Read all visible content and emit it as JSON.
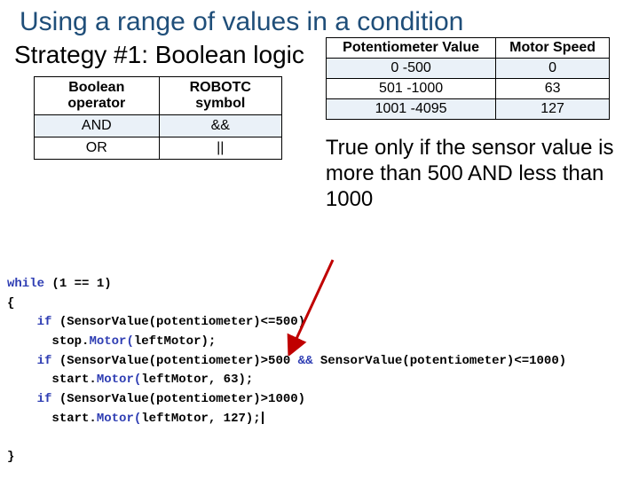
{
  "title": "Using a range of values in a condition",
  "subtitle": "Strategy #1: Boolean logic",
  "bool_table": {
    "headers": [
      "Boolean operator",
      "ROBOTC symbol"
    ],
    "rows": [
      [
        "AND",
        "&&"
      ],
      [
        "OR",
        "||"
      ]
    ]
  },
  "speed_table": {
    "headers": [
      "Potentiometer Value",
      "Motor Speed"
    ],
    "rows": [
      [
        "0 -500",
        "0"
      ],
      [
        "501 -1000",
        "63"
      ],
      [
        "1001 -4095",
        "127"
      ]
    ]
  },
  "explain": "True only if the sensor value is more than 500 AND less than 1000",
  "code": {
    "kw_while": "while",
    "cond1": " (1 == 1)",
    "lbrace": "{",
    "kw_if": "if",
    "if1": " (SensorValue(potentiometer)<=500)",
    "stmt1a": "stop.",
    "stmt1b": "Motor(",
    "stmt1c": "leftMotor);",
    "if2a": " (SensorValue(potentiometer)>500 ",
    "op_and": "&&",
    "if2b": " SensorValue(potentiometer)<=1000)",
    "stmt2a": "start.",
    "stmt2b": "Motor(",
    "stmt2c": "leftMotor, 63);",
    "if3": " (SensorValue(potentiometer)>1000)",
    "stmt3a": "start.",
    "stmt3b": "Motor(",
    "stmt3c": "leftMotor, 127);",
    "rbrace": "}"
  },
  "chart_data": [
    {
      "type": "table",
      "title": "Boolean operators to ROBOTC symbols",
      "columns": [
        "Boolean operator",
        "ROBOTC symbol"
      ],
      "rows": [
        [
          "AND",
          "&&"
        ],
        [
          "OR",
          "||"
        ]
      ]
    },
    {
      "type": "table",
      "title": "Potentiometer value to motor speed mapping",
      "columns": [
        "Potentiometer Value",
        "Motor Speed"
      ],
      "rows": [
        [
          "0-500",
          0
        ],
        [
          "501-1000",
          63
        ],
        [
          "1001-4095",
          127
        ]
      ]
    }
  ]
}
